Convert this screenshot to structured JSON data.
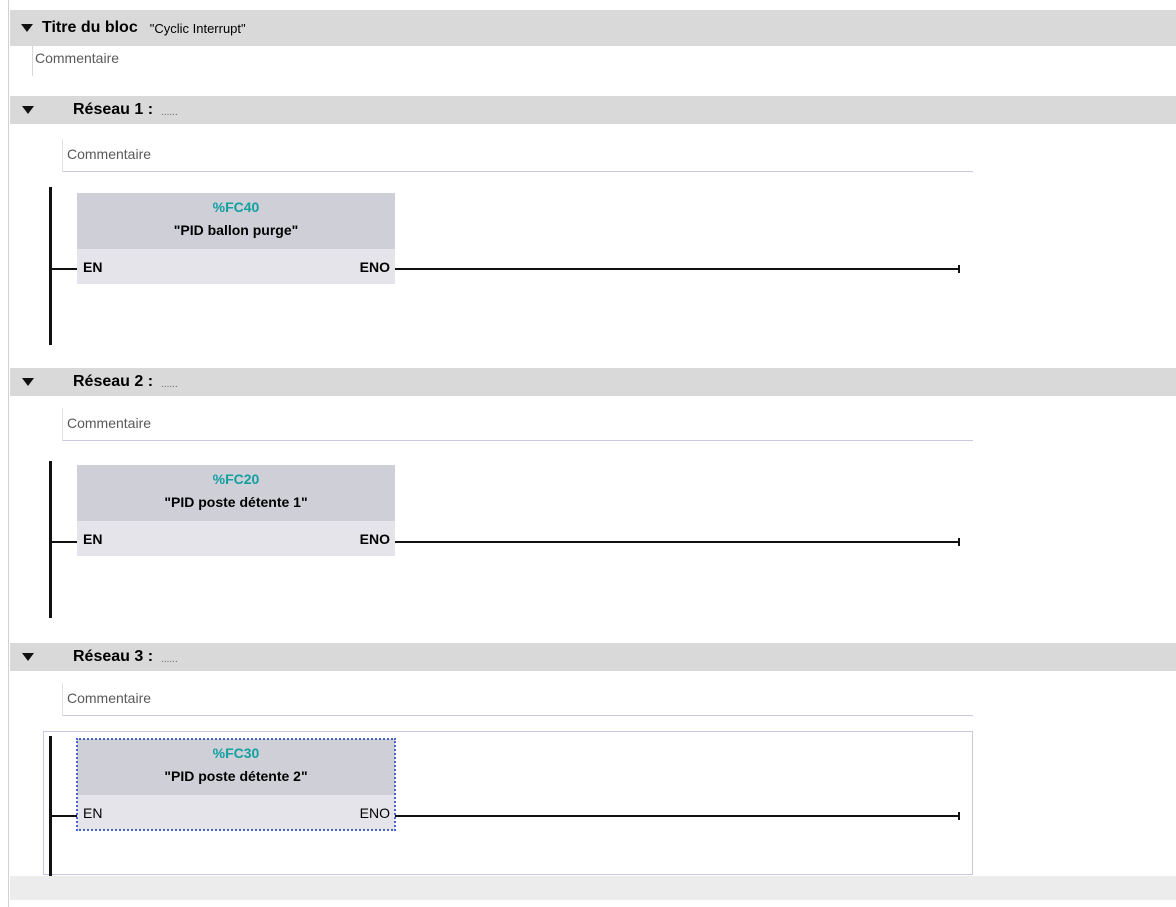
{
  "block": {
    "title": "Titre du bloc",
    "name": "\"Cyclic Interrupt\"",
    "comment": "Commentaire"
  },
  "networks": [
    {
      "title": "Réseau 1 :",
      "dots": "......",
      "comment": "Commentaire",
      "block_id": "%FC40",
      "block_name": "\"PID ballon purge\"",
      "en": "EN",
      "eno": "ENO"
    },
    {
      "title": "Réseau 2 :",
      "dots": "......",
      "comment": "Commentaire",
      "block_id": "%FC20",
      "block_name": "\"PID poste détente 1\"",
      "en": "EN",
      "eno": "ENO"
    },
    {
      "title": "Réseau 3 :",
      "dots": "......",
      "comment": "Commentaire",
      "block_id": "%FC30",
      "block_name": "\"PID poste détente 2\"",
      "en": "EN",
      "eno": "ENO",
      "selected": true
    }
  ],
  "colors": {
    "block_id": "#12a0a0",
    "header_bar": "#d9d9d9",
    "box": "#e4e4ea",
    "selection": "#4a63c8"
  },
  "icons": {
    "collapse": "triangle-down-icon"
  }
}
